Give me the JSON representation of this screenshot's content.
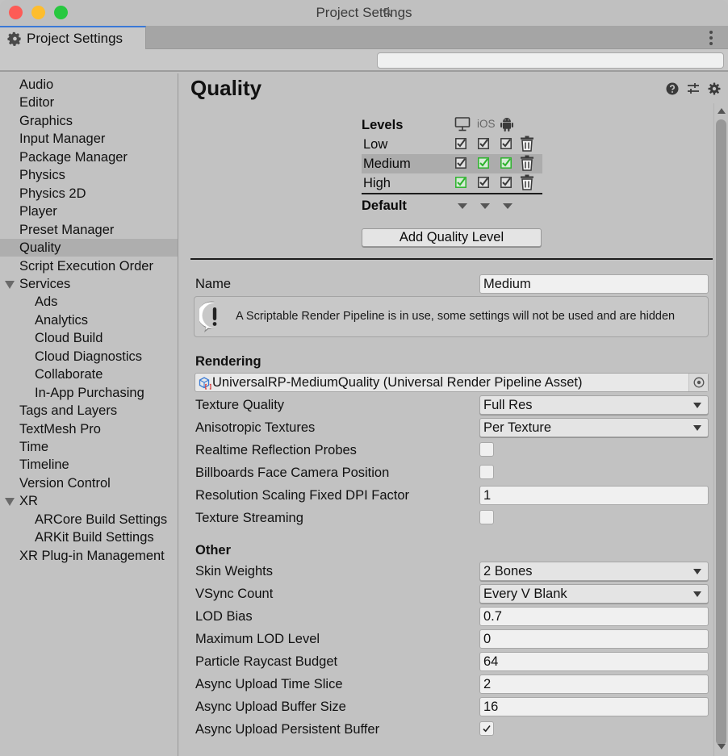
{
  "window": {
    "title": "Project Settings",
    "tab_label": "Project Settings"
  },
  "search": {
    "placeholder": "",
    "value": ""
  },
  "sidebar": {
    "items": [
      {
        "label": "Audio",
        "level": 0
      },
      {
        "label": "Editor",
        "level": 0
      },
      {
        "label": "Graphics",
        "level": 0
      },
      {
        "label": "Input Manager",
        "level": 0
      },
      {
        "label": "Package Manager",
        "level": 0
      },
      {
        "label": "Physics",
        "level": 0
      },
      {
        "label": "Physics 2D",
        "level": 0
      },
      {
        "label": "Player",
        "level": 0
      },
      {
        "label": "Preset Manager",
        "level": 0
      },
      {
        "label": "Quality",
        "level": 0,
        "selected": true
      },
      {
        "label": "Script Execution Order",
        "level": 0
      },
      {
        "label": "Services",
        "level": 0,
        "expanded": true
      },
      {
        "label": "Ads",
        "level": 1
      },
      {
        "label": "Analytics",
        "level": 1
      },
      {
        "label": "Cloud Build",
        "level": 1
      },
      {
        "label": "Cloud Diagnostics",
        "level": 1
      },
      {
        "label": "Collaborate",
        "level": 1
      },
      {
        "label": "In-App Purchasing",
        "level": 1
      },
      {
        "label": "Tags and Layers",
        "level": 0
      },
      {
        "label": "TextMesh Pro",
        "level": 0
      },
      {
        "label": "Time",
        "level": 0
      },
      {
        "label": "Timeline",
        "level": 0
      },
      {
        "label": "Version Control",
        "level": 0
      },
      {
        "label": "XR",
        "level": 0,
        "expanded": true
      },
      {
        "label": "ARCore Build Settings",
        "level": 1
      },
      {
        "label": "ARKit Build Settings",
        "level": 1
      },
      {
        "label": "XR Plug-in Management",
        "level": 0
      }
    ]
  },
  "main": {
    "title": "Quality",
    "header_icons": [
      "help-icon",
      "preset-sliders-icon",
      "gear-icon"
    ],
    "levels": {
      "heading": "Levels",
      "platforms": [
        {
          "name": "Standalone",
          "icon": "monitor-icon"
        },
        {
          "name": "iOS",
          "label": "iOS",
          "icon": "ios-icon"
        },
        {
          "name": "Android",
          "icon": "android-icon"
        }
      ],
      "rows": [
        {
          "name": "Low",
          "checks": [
            true,
            true,
            true
          ],
          "default_for": [
            false,
            false,
            false
          ],
          "selected": false
        },
        {
          "name": "Medium",
          "checks": [
            true,
            true,
            true
          ],
          "default_for": [
            false,
            true,
            true
          ],
          "selected": true
        },
        {
          "name": "High",
          "checks": [
            true,
            true,
            true
          ],
          "default_for": [
            true,
            false,
            false
          ],
          "selected": false
        }
      ],
      "default_label": "Default",
      "add_button": "Add Quality Level"
    },
    "name_label": "Name",
    "name_value": "Medium",
    "help_message": "A Scriptable Render Pipeline is in use, some settings will not be used and are hidden",
    "rendering": {
      "heading": "Rendering",
      "pipeline_asset": "UniversalRP-MediumQuality (Universal Render Pipeline Asset)",
      "texture_quality": {
        "label": "Texture Quality",
        "value": "Full Res"
      },
      "anisotropic": {
        "label": "Anisotropic Textures",
        "value": "Per Texture"
      },
      "realtime_reflection": {
        "label": "Realtime Reflection Probes",
        "checked": false
      },
      "billboards": {
        "label": "Billboards Face Camera Position",
        "checked": false
      },
      "dpi_factor": {
        "label": "Resolution Scaling Fixed DPI Factor",
        "value": "1"
      },
      "texture_streaming": {
        "label": "Texture Streaming",
        "checked": false
      }
    },
    "other": {
      "heading": "Other",
      "skin_weights": {
        "label": "Skin Weights",
        "value": "2 Bones"
      },
      "vsync": {
        "label": "VSync Count",
        "value": "Every V Blank"
      },
      "lod_bias": {
        "label": "LOD Bias",
        "value": "0.7"
      },
      "max_lod": {
        "label": "Maximum LOD Level",
        "value": "0"
      },
      "particle_budget": {
        "label": "Particle Raycast Budget",
        "value": "64"
      },
      "async_time_slice": {
        "label": "Async Upload Time Slice",
        "value": "2"
      },
      "async_buffer_size": {
        "label": "Async Upload Buffer Size",
        "value": "16"
      },
      "async_persistent": {
        "label": "Async Upload Persistent Buffer",
        "checked": true
      }
    }
  },
  "colors": {
    "accent_tab": "#3a78d6",
    "default_check": "#2db32d",
    "selected_row": "#acacac"
  }
}
